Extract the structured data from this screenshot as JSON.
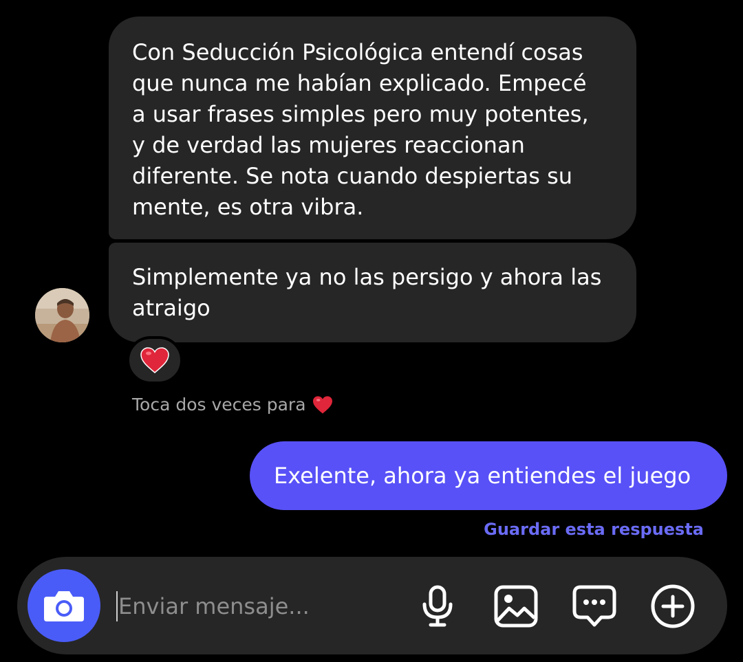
{
  "messages": {
    "incoming": [
      "Con Seducción Psicológica entendí cosas\nque nunca me habían explicado. Empecé\na usar frases simples pero muy potentes,\ny de verdad las mujeres reaccionan\ndiferente. Se nota cuando despiertas su\nmente, es otra vibra.",
      "Simplemente ya no las persigo y ahora las\natraigo"
    ],
    "reaction": "❤️",
    "hint": "Toca dos veces para",
    "hint_emoji": "❤️",
    "outgoing": "Exelente, ahora ya entiendes el juego",
    "save_reply": "Guardar esta respuesta"
  },
  "composer": {
    "placeholder": "Enviar mensaje...",
    "icons": [
      "camera-icon",
      "microphone-icon",
      "gallery-icon",
      "sticker-icon",
      "plus-icon"
    ]
  },
  "colors": {
    "background": "#000000",
    "incoming_bubble": "#262626",
    "outgoing_bubble": "#5851f7",
    "accent_link": "#6a6bf4",
    "camera_button": "#4a5cf7"
  }
}
